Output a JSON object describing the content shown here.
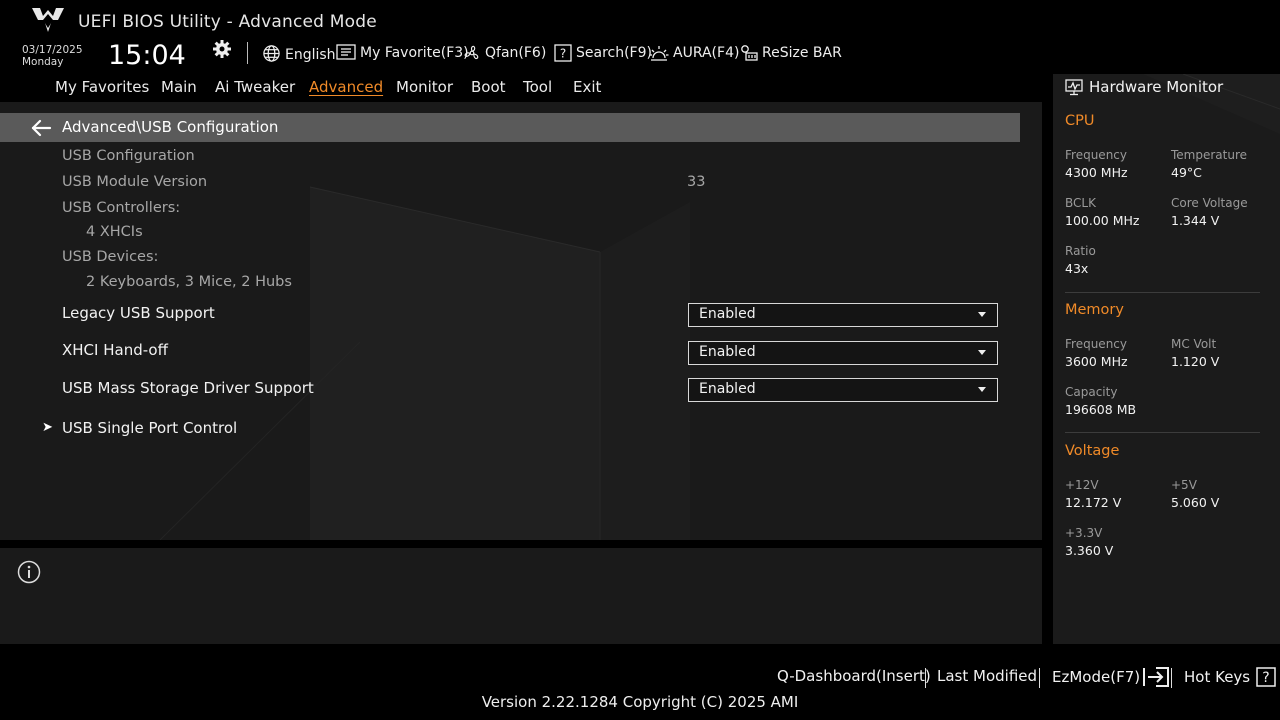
{
  "header": {
    "title": "UEFI BIOS Utility - Advanced Mode",
    "date": "03/17/2025",
    "weekday": "Monday",
    "time": "15:04",
    "toolbar": {
      "language": "English",
      "favorite": "My Favorite(F3)",
      "qfan": "Qfan(F6)",
      "search": "Search(F9)",
      "aura": "AURA(F4)",
      "resize_bar": "ReSize BAR"
    }
  },
  "tabs": [
    "My Favorites",
    "Main",
    "Ai Tweaker",
    "Advanced",
    "Monitor",
    "Boot",
    "Tool",
    "Exit"
  ],
  "active_tab": "Advanced",
  "breadcrumb": "Advanced\\USB Configuration",
  "content": {
    "section_title": "USB Configuration",
    "module_version_label": "USB Module Version",
    "module_version_value": "33",
    "controllers_label": "USB Controllers:",
    "controllers_value": "4 XHCIs",
    "devices_label": "USB Devices:",
    "devices_value": "2 Keyboards, 3 Mice, 2 Hubs",
    "settings": [
      {
        "label": "Legacy USB Support",
        "value": "Enabled"
      },
      {
        "label": "XHCI Hand-off",
        "value": "Enabled"
      },
      {
        "label": "USB Mass Storage Driver Support",
        "value": "Enabled"
      }
    ],
    "submenu": "USB Single Port Control"
  },
  "hardware_monitor": {
    "title": "Hardware Monitor",
    "cpu": {
      "title": "CPU",
      "frequency_label": "Frequency",
      "frequency": "4300 MHz",
      "temperature_label": "Temperature",
      "temperature": "49°C",
      "bclk_label": "BCLK",
      "bclk": "100.00 MHz",
      "core_voltage_label": "Core Voltage",
      "core_voltage": "1.344 V",
      "ratio_label": "Ratio",
      "ratio": "43x"
    },
    "memory": {
      "title": "Memory",
      "frequency_label": "Frequency",
      "frequency": "3600 MHz",
      "mc_volt_label": "MC Volt",
      "mc_volt": "1.120 V",
      "capacity_label": "Capacity",
      "capacity": "196608 MB"
    },
    "voltage": {
      "title": "Voltage",
      "v12_label": "+12V",
      "v12": "12.172 V",
      "v5_label": "+5V",
      "v5": "5.060 V",
      "v33_label": "+3.3V",
      "v33": "3.360 V"
    }
  },
  "footer": {
    "q_dashboard": "Q-Dashboard(Insert)",
    "last_modified": "Last Modified",
    "ezmode": "EzMode(F7)",
    "hot_keys": "Hot Keys",
    "version": "Version 2.22.1284 Copyright (C) 2025 AMI"
  },
  "colors": {
    "accent": "#f08a28",
    "panel": "#1a1a1a",
    "breadcrumb_bar": "#5a5a5a"
  }
}
